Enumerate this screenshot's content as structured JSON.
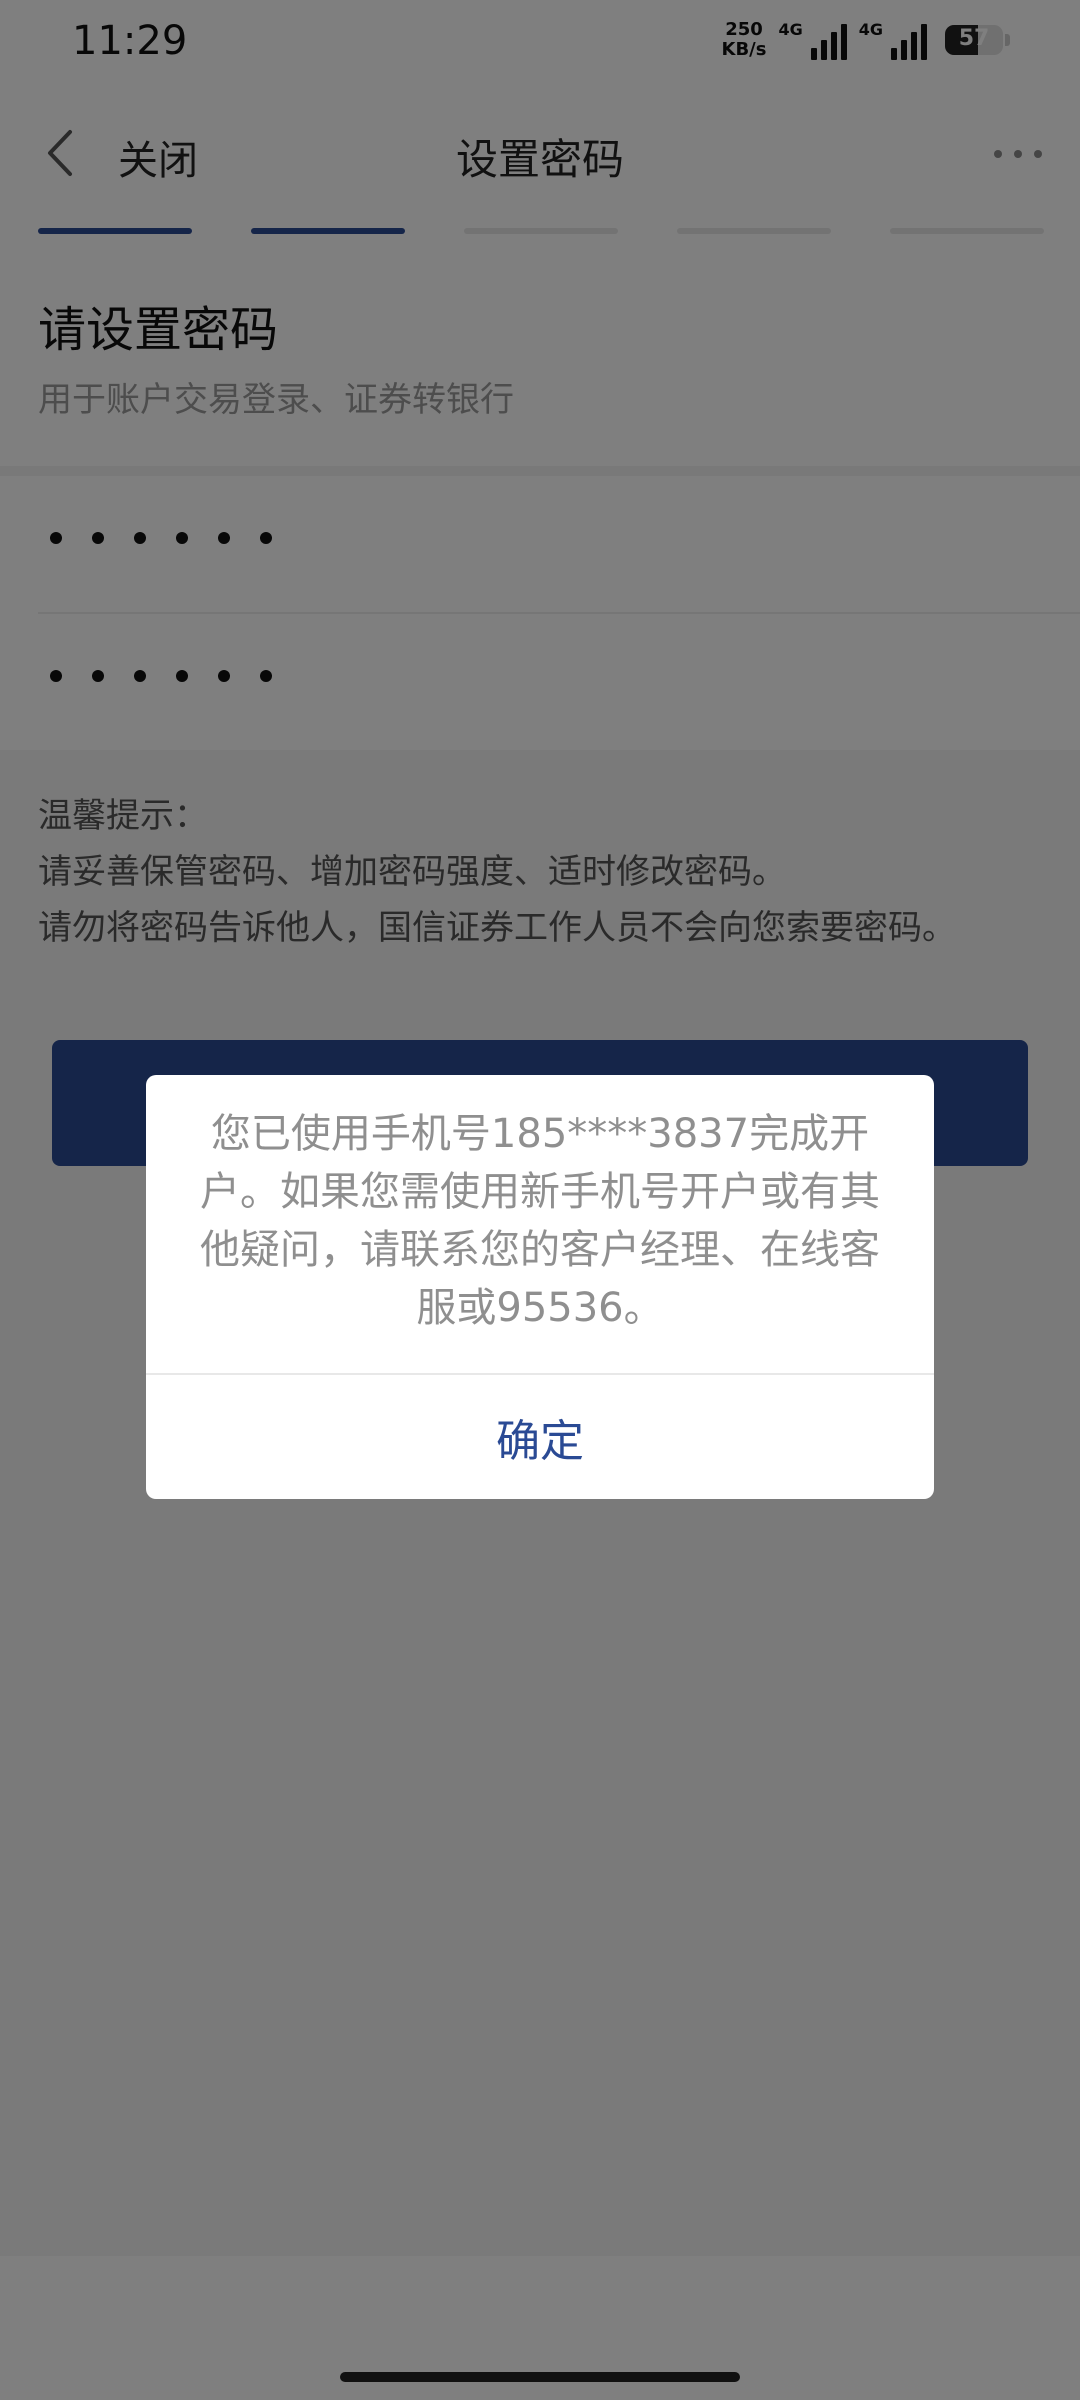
{
  "status_bar": {
    "time": "11:29",
    "net_speed_value": "250",
    "net_speed_unit": "KB/s",
    "signal_1_label": "4G",
    "signal_2_label": "4G",
    "battery_level": "57"
  },
  "nav": {
    "close_label": "关闭",
    "title": "设置密码"
  },
  "progress": {
    "total_steps": 5,
    "completed_steps": 2
  },
  "header": {
    "title": "请设置密码",
    "subtitle": "用于账户交易登录、证券转银行"
  },
  "password_fields": [
    {
      "masked_length": 6
    },
    {
      "masked_length": 6
    }
  ],
  "tips": {
    "heading": "温馨提示：",
    "line_1": "请妥善保管密码、增加密码强度、适时修改密码。",
    "line_2": "请勿将密码告诉他人，国信证券工作人员不会向您索要密码。"
  },
  "dialog": {
    "message": "您已使用手机号185****3837完成开户。如果您需使用新手机号开户或有其他疑问，请联系您的客户经理、在线客服或95536。",
    "confirm_label": "确定"
  },
  "colors": {
    "accent": "#2b4a92",
    "accent_text": "#2a4a94",
    "step_inactive": "#e6e6e6"
  }
}
